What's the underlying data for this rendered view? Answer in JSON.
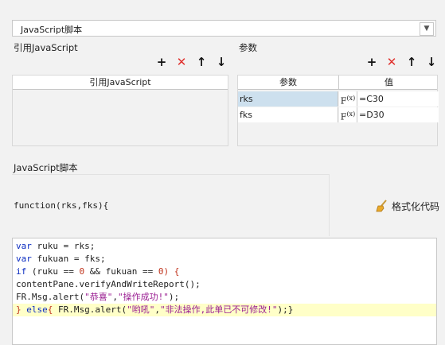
{
  "dropdown": {
    "value": "JavaScript脚本"
  },
  "ref_section": {
    "title": "引用JavaScript",
    "column_header": "引用JavaScript",
    "rows": []
  },
  "params_section": {
    "title": "参数",
    "columns": {
      "name": "参数",
      "value": "值"
    },
    "rows": [
      {
        "name": "rks",
        "fx": "F(x)",
        "value": "=C30"
      },
      {
        "name": "fks",
        "fx": "F(x)",
        "value": "=D30"
      }
    ]
  },
  "script_section": {
    "title": "JavaScript脚本",
    "signature": "function(rks,fks){",
    "format_button": "格式化代码"
  },
  "code_lines": [
    [
      {
        "t": "var",
        "c": "kw"
      },
      {
        "t": " ruku = rks;",
        "c": ""
      }
    ],
    [
      {
        "t": "var",
        "c": "kw"
      },
      {
        "t": " fukuan = fks;",
        "c": ""
      }
    ],
    [
      {
        "t": "if",
        "c": "kw"
      },
      {
        "t": " (ruku == ",
        "c": ""
      },
      {
        "t": "0",
        "c": "num"
      },
      {
        "t": " && fukuan == ",
        "c": ""
      },
      {
        "t": "0",
        "c": "num"
      },
      {
        "t": ") {",
        "c": "red"
      }
    ],
    [
      {
        "t": "contentPane.verifyAndWriteReport();",
        "c": ""
      }
    ],
    [
      {
        "t": "FR.Msg.alert(",
        "c": ""
      },
      {
        "t": "\"恭喜\"",
        "c": "str"
      },
      {
        "t": ",",
        "c": ""
      },
      {
        "t": "\"操作成功!\"",
        "c": "str"
      },
      {
        "t": ");",
        "c": ""
      }
    ],
    [
      {
        "t": "} ",
        "c": "red"
      },
      {
        "t": "else",
        "c": "kw"
      },
      {
        "t": "{ ",
        "c": "red"
      },
      {
        "t": "FR.Msg.alert(",
        "c": ""
      },
      {
        "t": "\"哟吼\"",
        "c": "str"
      },
      {
        "t": ",",
        "c": ""
      },
      {
        "t": "\"非法操作,此单已不可修改!\"",
        "c": "str"
      },
      {
        "t": ");}",
        "c": ""
      }
    ]
  ],
  "highlighted_line": 5,
  "colors": {
    "keyword": "#0b2cc1",
    "string": "#9a1e92",
    "number": "#c0341d",
    "delete": "#e0302c",
    "highlight": "#ffffc8",
    "selected_cell": "#cde0ee"
  }
}
